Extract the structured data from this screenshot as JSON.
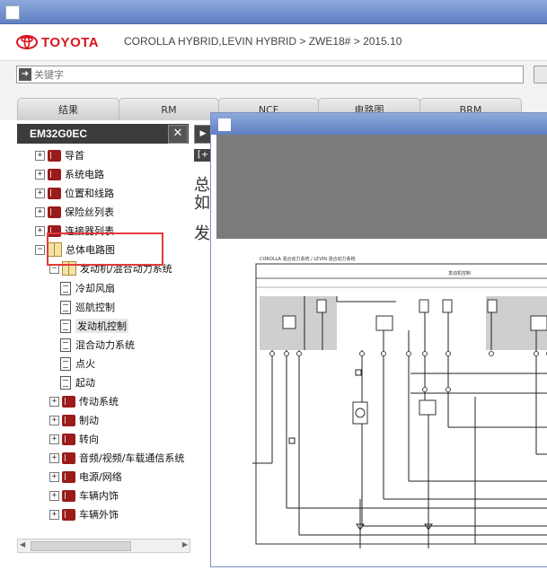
{
  "header": {
    "brand": "TOYOTA",
    "breadcrumb": "COROLLA HYBRID,LEVIN HYBRID > ZWE18# > 2015.10"
  },
  "search": {
    "placeholder": "关键字"
  },
  "tabs": [
    {
      "label": "结果"
    },
    {
      "label": "RM"
    },
    {
      "label": "NCF"
    },
    {
      "label": "电路图"
    },
    {
      "label": "BRM"
    }
  ],
  "panel": {
    "code": "EM32G0EC",
    "close_symbol": "✕",
    "arrow_symbol": "▶"
  },
  "tree": {
    "items": [
      {
        "label": "导首"
      },
      {
        "label": "系统电路"
      },
      {
        "label": "位置和线路"
      },
      {
        "label": "保险丝列表"
      },
      {
        "label": "连接器列表"
      },
      {
        "label": "总体电路图"
      },
      {
        "label": "发动机/混合动力系统"
      },
      {
        "label": "冷却风扇"
      },
      {
        "label": "巡航控制"
      },
      {
        "label": "发动机控制"
      },
      {
        "label": "混合动力系统"
      },
      {
        "label": "点火"
      },
      {
        "label": "起动"
      },
      {
        "label": "传动系统"
      },
      {
        "label": "制动"
      },
      {
        "label": "转向"
      },
      {
        "label": "音频/视频/车载通信系统"
      },
      {
        "label": "电源/网络"
      },
      {
        "label": "车辆内饰"
      },
      {
        "label": "车辆外饰"
      }
    ]
  },
  "middle": {
    "button": "[+",
    "line1": "总",
    "line2": "如",
    "line3": "发"
  },
  "diagram": {
    "header_text": "COROLLA 混合动力系统 / LEVIN 混合动力系统",
    "section_title": "发动机控制"
  },
  "colors": {
    "accent": "#d8141c",
    "titlebar": "#6f8fd0",
    "highlight": "#e23b3b",
    "panel_header": "#3b3b3b"
  }
}
